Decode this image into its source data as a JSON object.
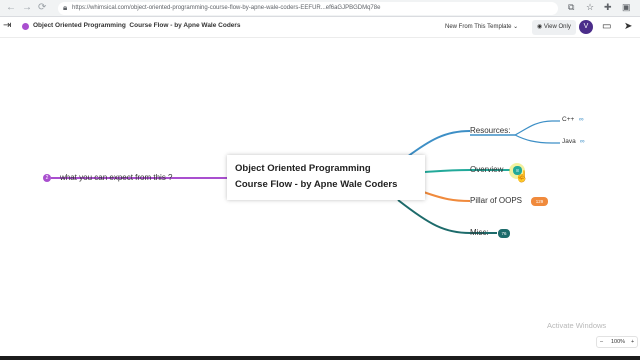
{
  "browser": {
    "url": "https://whimsical.com/object-oriented-programming-course-flow-by-apne-wale-coders-EEFUR...ef6aGJPBGDMq78e",
    "back_icon": "arrow-left-icon",
    "forward_icon": "arrow-right-icon",
    "refresh_icon": "refresh-icon"
  },
  "app": {
    "doc_title": "Object Oriented Programming  Course Flow - by Apne Wale Coders",
    "new_from_template_label": "New From This Template",
    "view_only_label": "View Only",
    "avatar_initial": "V"
  },
  "mindmap": {
    "central_line1": "Object Oriented Programming",
    "central_line2": "Course Flow - by Apne Wale Coders",
    "left_number": "2",
    "left_node": "what you can expect from this ?",
    "resources": "Resources:",
    "cpp": "C++",
    "java": "Java",
    "overview": "Overview",
    "overview_badge": "8",
    "pillars": "Pillar of OOPS",
    "pillars_badge": "129",
    "misc": "Misc:",
    "misc_badge": "76"
  },
  "colors": {
    "resources": "#3d8fc6",
    "overview": "#22a99a",
    "pillars": "#f08a3c",
    "misc": "#1d6b6b",
    "left": "#a94fcf"
  },
  "watermark": "Activate Windows",
  "zoom": "100%"
}
